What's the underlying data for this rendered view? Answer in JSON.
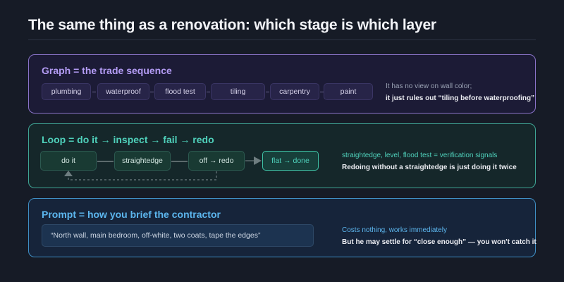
{
  "title": "The same thing as a renovation: which stage is which layer",
  "graph": {
    "heading": "Graph = the trade sequence",
    "steps": [
      "plumbing",
      "waterproof",
      "flood test",
      "tiling",
      "carpentry",
      "paint"
    ],
    "note_line1": "It has no view on wall color;",
    "note_line2": "it just rules out “tiling before waterproofing”"
  },
  "loop": {
    "heading": "Loop = do it → inspect → fail → redo",
    "steps": [
      "do it",
      "straightedge",
      "off → redo",
      "flat → done"
    ],
    "note_line1": "straightedge, level, flood test = verification signals",
    "note_line2": "Redoing without a straightedge is just doing it twice"
  },
  "prompt": {
    "heading": "Prompt = how you brief the contractor",
    "quote": "“North wall, main bedroom, off-white, two coats, tape the edges”",
    "note_line1": "Costs nothing, works immediately",
    "note_line2": "But he may settle for “close enough” — you won't catch it"
  },
  "colors": {
    "graph_accent": "#b49cf5",
    "loop_accent": "#4fd1bb",
    "prompt_accent": "#5cb6ee",
    "background": "#161b26"
  }
}
